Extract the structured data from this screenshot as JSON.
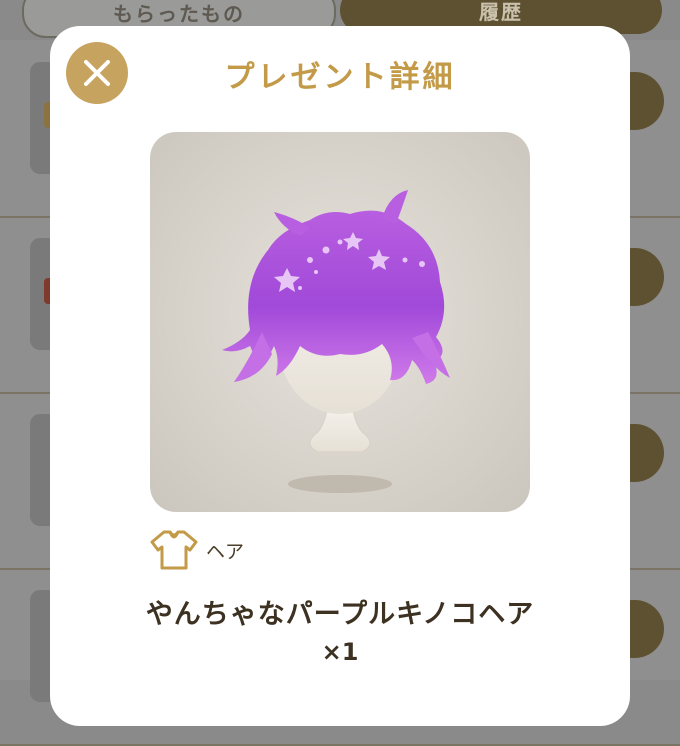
{
  "tabs": {
    "received": "もらったもの",
    "history": "履歴"
  },
  "modal": {
    "title": "プレゼント詳細",
    "close_icon": "close-x-icon",
    "item": {
      "image_name": "purple-mushroom-wig-hair",
      "category_icon": "shirt-icon",
      "category": "ヘア",
      "name": "やんちゃなパープルキノコヘア",
      "quantity": "×1"
    }
  },
  "colors": {
    "accent_gold": "#c6a35f",
    "title_gold": "#c39a48",
    "dark_brown": "#5e5131",
    "text_dark": "#3d3222"
  }
}
